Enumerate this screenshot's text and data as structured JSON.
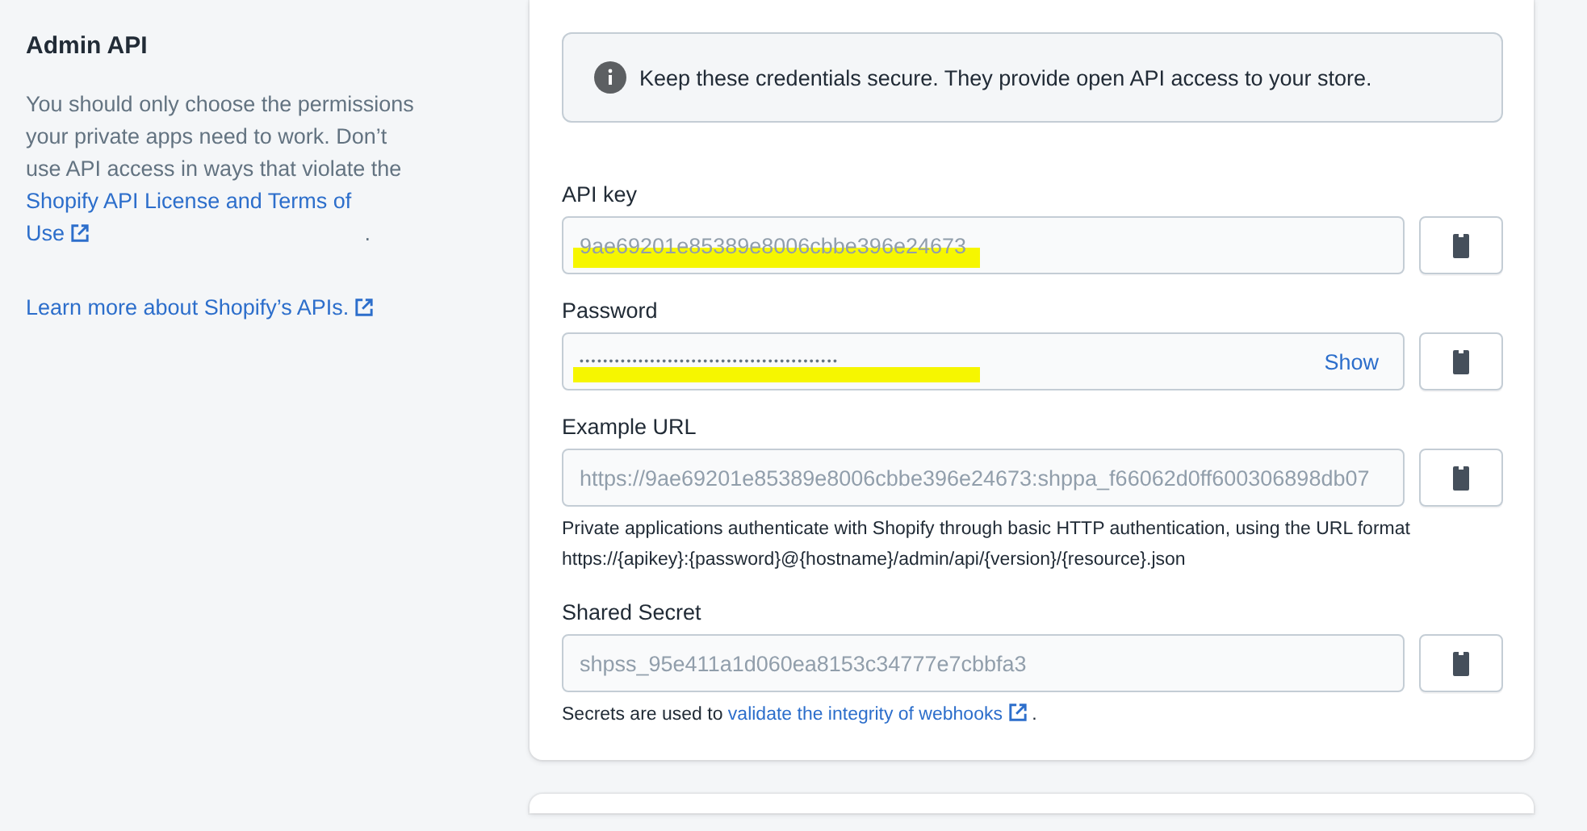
{
  "sidebar": {
    "title": "Admin API",
    "description": "You should only choose the permissions your private apps need to work. Don’t use API access in ways that violate the",
    "license_link": "Shopify API License and Terms of Use",
    "after_link": ".",
    "learn_more_link": "Learn more about Shopify’s APIs."
  },
  "notice": {
    "text": "Keep these credentials secure. They provide open API access to your store."
  },
  "fields": [
    {
      "kind": "text",
      "label": "API key",
      "value": "9ae69201e85389e8006cbbe396e24673",
      "highlighted": true
    },
    {
      "kind": "password",
      "label": "Password",
      "value": "••••••••••••••••••••••••••••••••••••••••••••",
      "show_button": "Show",
      "highlighted": true
    },
    {
      "kind": "text",
      "label": "Example URL",
      "value": "https://9ae69201e85389e8006cbbe396e24673:shppa_f66062d0ff600306898db07",
      "highlighted": false,
      "help": "Private applications authenticate with Shopify through basic HTTP authentication, using the URL format https://{apikey}:{password}@{hostname}/admin/api/{version}/{resource}.json"
    },
    {
      "kind": "text",
      "label": "Shared Secret",
      "value": "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",
      "highlighted": false,
      "help_prefix": "Secrets are used to",
      "help_link": "validate the integrity of webhooks",
      "help_suffix": "."
    }
  ]
}
